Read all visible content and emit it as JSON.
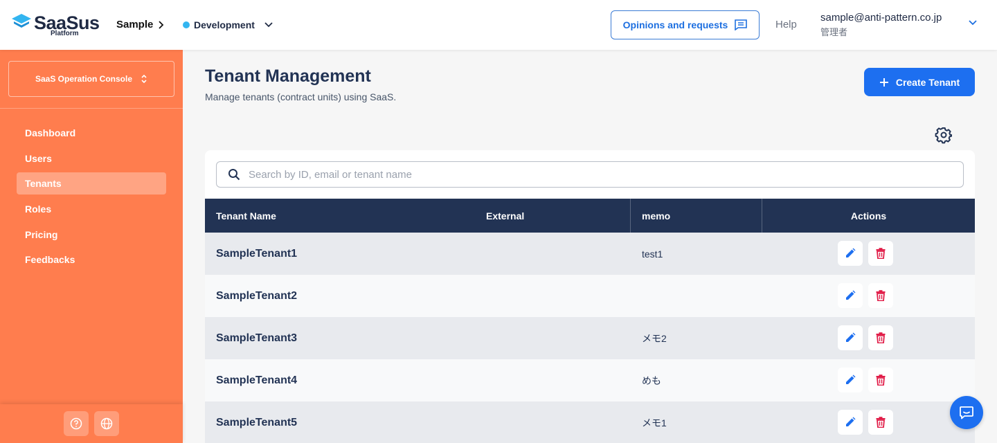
{
  "brand": {
    "name": "SaaSus",
    "sub": "Platform"
  },
  "header": {
    "breadcrumb": "Sample",
    "environment": "Development",
    "opinion_button": "Opinions and requests",
    "help": "Help",
    "user_email": "sample@anti-pattern.co.jp",
    "user_role": "管理者"
  },
  "sidebar": {
    "console_selector": "SaaS Operation Console",
    "items": [
      {
        "label": "Dashboard",
        "active": false
      },
      {
        "label": "Users",
        "active": false
      },
      {
        "label": "Tenants",
        "active": true
      },
      {
        "label": "Roles",
        "active": false
      },
      {
        "label": "Pricing",
        "active": false
      },
      {
        "label": "Feedbacks",
        "active": false
      }
    ]
  },
  "page": {
    "title": "Tenant Management",
    "subtitle": "Manage tenants (contract units) using SaaS.",
    "create_button": "Create Tenant"
  },
  "search": {
    "placeholder": "Search by ID, email or tenant name",
    "value": ""
  },
  "table": {
    "columns": [
      "Tenant Name",
      "External",
      "memo",
      "Actions"
    ],
    "rows": [
      {
        "name": "SampleTenant1",
        "external": "",
        "memo": "test1"
      },
      {
        "name": "SampleTenant2",
        "external": "",
        "memo": ""
      },
      {
        "name": "SampleTenant3",
        "external": "",
        "memo": "メモ2"
      },
      {
        "name": "SampleTenant4",
        "external": "",
        "memo": "めも"
      },
      {
        "name": "SampleTenant5",
        "external": "",
        "memo": "メモ1"
      }
    ]
  },
  "colors": {
    "sidebar": "#ff7d4e",
    "table_header": "#223354",
    "primary": "#1d6ff0",
    "delete": "#e11d48",
    "env_dot": "#33b5f0"
  },
  "icons": [
    "logo-icon",
    "chevron-right-icon",
    "chevron-down-icon",
    "feedback-icon",
    "unfold-icon",
    "help-icon",
    "globe-icon",
    "plus-icon",
    "gear-icon",
    "search-icon",
    "edit-icon",
    "trash-icon",
    "chat-icon"
  ]
}
